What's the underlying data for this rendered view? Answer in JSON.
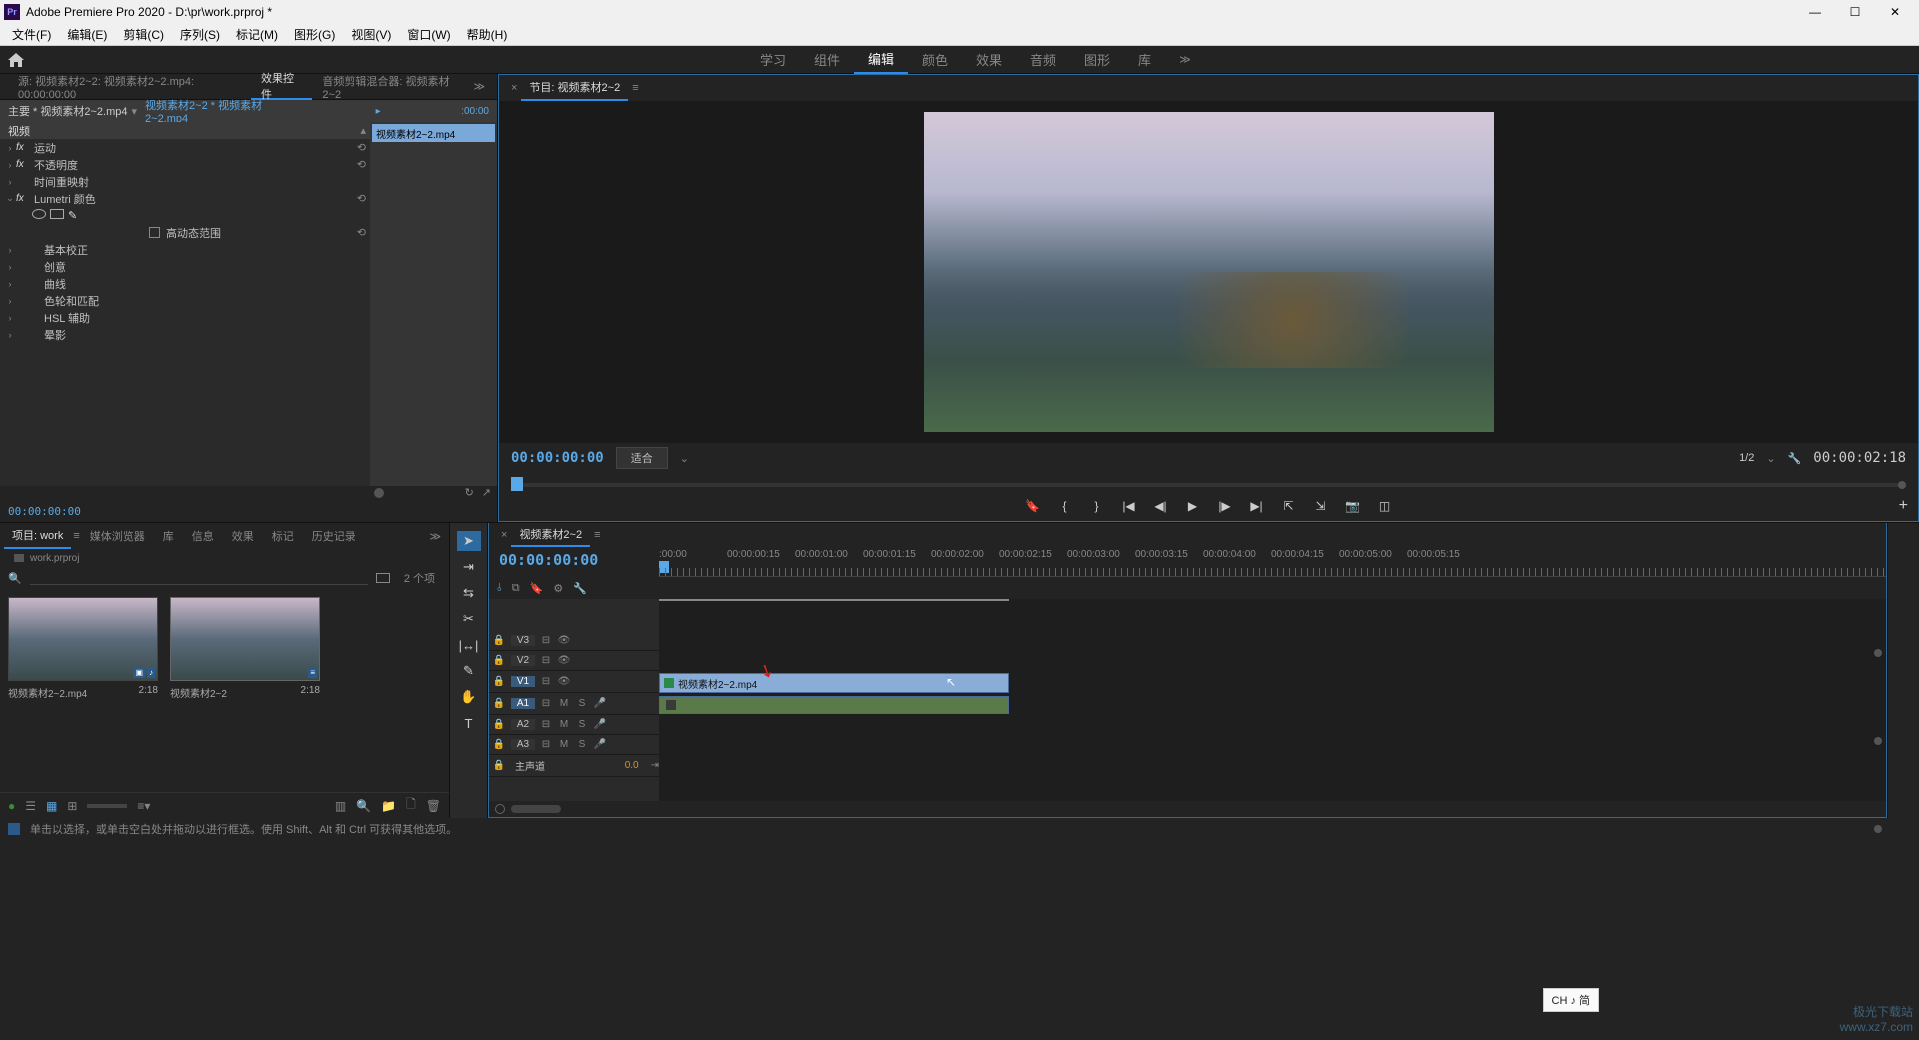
{
  "app": {
    "title": "Adobe Premiere Pro 2020 - D:\\pr\\work.prproj *",
    "logo": "Pr"
  },
  "menu": [
    "文件(F)",
    "编辑(E)",
    "剪辑(C)",
    "序列(S)",
    "标记(M)",
    "图形(G)",
    "视图(V)",
    "窗口(W)",
    "帮助(H)"
  ],
  "workspaces": {
    "items": [
      "学习",
      "组件",
      "编辑",
      "颜色",
      "效果",
      "音频",
      "图形",
      "库"
    ],
    "active": 2
  },
  "source_panel": {
    "tabs": [
      "源: 视频素材2~2: 视频素材2~2.mp4: 00:00:00:00",
      "效果控件",
      "音频剪辑混合器: 视频素材2~2"
    ],
    "active": 1,
    "master_label": "主要 * 视频素材2~2.mp4",
    "clip_label": "视频素材2~2 * 视频素材2~2.mp4",
    "timeline_tc": ":00:00",
    "timeline_clip": "视频素材2~2.mp4",
    "sections": {
      "video": "视频",
      "motion": "运动",
      "opacity": "不透明度",
      "timeremap": "时间重映射",
      "lumetri": "Lumetri 颜色",
      "hdr": "高动态范围",
      "basic": "基本校正",
      "creative": "创意",
      "curves": "曲线",
      "colorwheel": "色轮和匹配",
      "hsl": "HSL 辅助",
      "vignette": "晕影"
    },
    "tc": "00:00:00:00"
  },
  "program": {
    "title": "节目: 视频素材2~2",
    "tc": "00:00:00:00",
    "fit": "适合",
    "resolution": "1/2",
    "duration": "00:00:02:18"
  },
  "project": {
    "tabs": [
      "项目: work",
      "媒体浏览器",
      "库",
      "信息",
      "效果",
      "标记",
      "历史记录"
    ],
    "active": 0,
    "name": "work.prproj",
    "count": "2 个项",
    "items": [
      {
        "name": "视频素材2~2.mp4",
        "dur": "2:18"
      },
      {
        "name": "视频素材2~2",
        "dur": "2:18"
      }
    ]
  },
  "timeline": {
    "title": "视频素材2~2",
    "tc": "00:00:00:00",
    "ruler": [
      ":00:00",
      "00:00:00:15",
      "00:00:01:00",
      "00:00:01:15",
      "00:00:02:00",
      "00:00:02:15",
      "00:00:03:00",
      "00:00:03:15",
      "00:00:04:00",
      "00:00:04:15",
      "00:00:05:00",
      "00:00:05:15"
    ],
    "tracks": {
      "v3": "V3",
      "v2": "V2",
      "v1": "V1",
      "a1": "A1",
      "a2": "A2",
      "a3": "A3",
      "master": "主声道",
      "master_val": "0.0"
    },
    "clip": "视频素材2~2.mp4"
  },
  "status": "单击以选择，或单击空白处并拖动以进行框选。使用 Shift、Alt 和 Ctrl 可获得其他选项。",
  "ime": "CH ♪ 简",
  "watermark1": "极光下载站",
  "watermark2": "www.xz7.com"
}
